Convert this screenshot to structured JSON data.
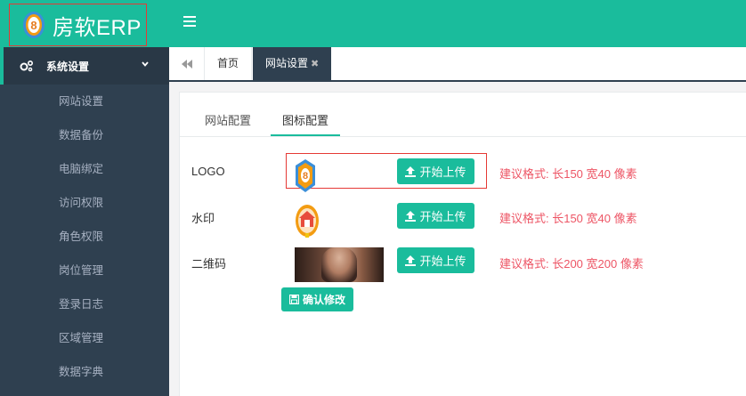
{
  "app": {
    "brand_text": "房软ERP",
    "menu_toggle_icon": "hamburger-icon"
  },
  "colors": {
    "accent": "#1abc9c",
    "sidebar": "#2f4050",
    "hint": "#ed5565",
    "highlight_box": "#e53935"
  },
  "sidebar": {
    "section_label": "系统设置",
    "section_icon": "gears-icon",
    "items": [
      {
        "label": "网站设置"
      },
      {
        "label": "数据备份"
      },
      {
        "label": "电脑绑定"
      },
      {
        "label": "访问权限"
      },
      {
        "label": "角色权限"
      },
      {
        "label": "岗位管理"
      },
      {
        "label": "登录日志"
      },
      {
        "label": "区域管理"
      },
      {
        "label": "数据字典"
      }
    ]
  },
  "tabs": {
    "home_label": "首页",
    "active_label": "网站设置",
    "close_glyph": "✖"
  },
  "subtabs": {
    "site_config": "网站配置",
    "icon_config": "图标配置"
  },
  "icon_config": {
    "rows": [
      {
        "label": "LOGO",
        "button": "开始上传",
        "hint": "建议格式: 长150 宽40 像素"
      },
      {
        "label": "水印",
        "button": "开始上传",
        "hint": "建议格式: 长150 宽40 像素"
      },
      {
        "label": "二维码",
        "button": "开始上传",
        "hint": "建议格式: 长200 宽200 像素"
      }
    ],
    "confirm_button": "确认修改"
  }
}
